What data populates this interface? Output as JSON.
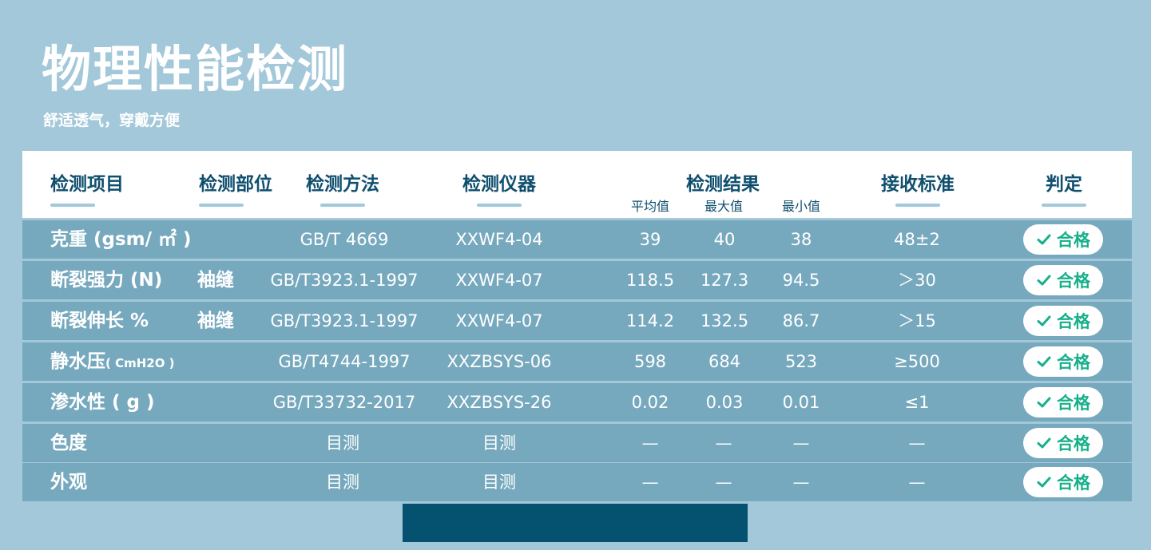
{
  "title": "物理性能检测",
  "subtitle": "舒适透气，穿戴方便",
  "colors": {
    "background": "#a3c8da",
    "row": "#77a9be",
    "header_text": "#0f4f6e",
    "pass_text": "#17b08a",
    "bottom_bar": "#04526f"
  },
  "table": {
    "headers": {
      "item": "检测项目",
      "part": "检测部位",
      "method": "检测方法",
      "instrument": "检测仪器",
      "result": "检测结果",
      "standard": "接收标准",
      "judgement": "判定"
    },
    "result_subheaders": {
      "avg": "平均值",
      "max": "最大值",
      "min": "最小值"
    },
    "rows": [
      {
        "item": "克重 (gsm/ ㎡ )",
        "part": "",
        "method": "GB/T 4669",
        "instrument": "XXWF4-04",
        "avg": "39",
        "max": "40",
        "min": "38",
        "standard": "48±2",
        "judgement": "合格"
      },
      {
        "item": "断裂强力 (N)",
        "part": "袖缝",
        "method": "GB/T3923.1-1997",
        "instrument": "XXWF4-07",
        "avg": "118.5",
        "max": "127.3",
        "min": "94.5",
        "standard": "＞30",
        "judgement": "合格"
      },
      {
        "item": "断裂伸长 %",
        "part": "袖缝",
        "method": "GB/T3923.1-1997",
        "instrument": "XXWF4-07",
        "avg": "114.2",
        "max": "132.5",
        "min": "86.7",
        "standard": "＞15",
        "judgement": "合格"
      },
      {
        "item": "静水压",
        "item_suffix": "( CmH2O )",
        "part": "",
        "method": "GB/T4744-1997",
        "instrument": "XXZBSYS-06",
        "avg": "598",
        "max": "684",
        "min": "523",
        "standard": "≥500",
        "judgement": "合格"
      },
      {
        "item": "渗水性 ( g )",
        "part": "",
        "method": "GB/T33732-2017",
        "instrument": "XXZBSYS-26",
        "avg": "0.02",
        "max": "0.03",
        "min": "0.01",
        "standard": "≤1",
        "judgement": "合格"
      },
      {
        "item": "色度",
        "part": "",
        "method": "目测",
        "instrument": "目测",
        "avg": "—",
        "max": "—",
        "min": "—",
        "standard": "—",
        "judgement": "合格"
      },
      {
        "item": "外观",
        "part": "",
        "method": "目测",
        "instrument": "目测",
        "avg": "—",
        "max": "—",
        "min": "—",
        "standard": "—",
        "judgement": "合格"
      }
    ]
  }
}
